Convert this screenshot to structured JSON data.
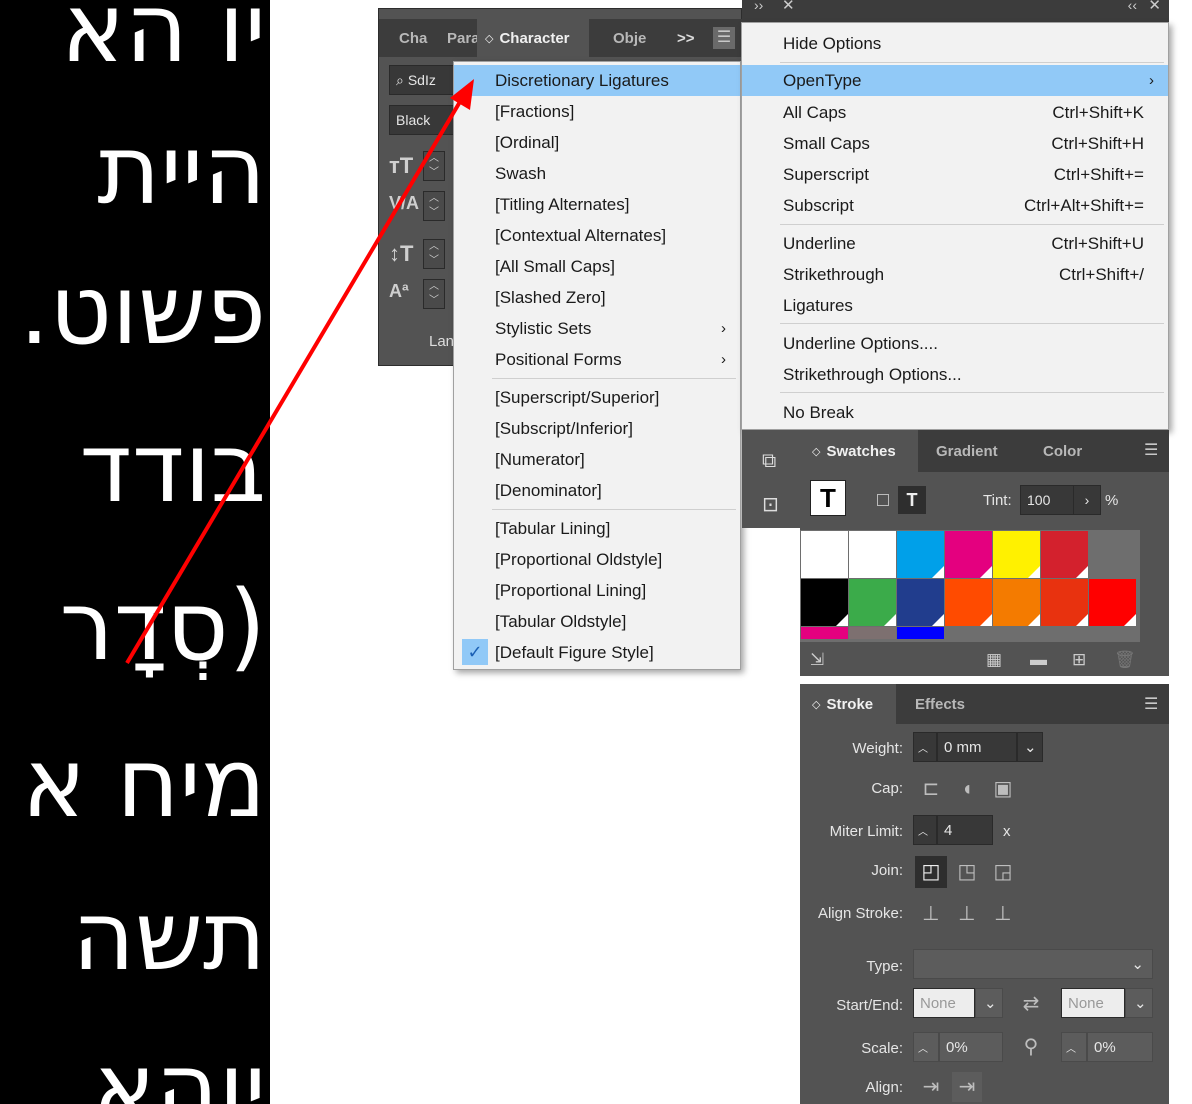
{
  "hebrew_lines": [
    "יו הא",
    "היית",
    "פשוט.",
    "בודד",
    "(סְדָר",
    "מיח א",
    "תשה",
    "יוהא"
  ],
  "character_panel": {
    "tabs": [
      "Cha",
      "Para",
      "Character",
      "Obje"
    ],
    "overflow": ">>",
    "font_field": "SdIz",
    "style_field": "Black",
    "language_label": "Lan"
  },
  "opentype_submenu": {
    "items": [
      "Discretionary Ligatures",
      "[Fractions]",
      "[Ordinal]",
      "Swash",
      "[Titling Alternates]",
      "[Contextual Alternates]",
      "[All Small Caps]",
      "[Slashed Zero]",
      "Stylistic Sets",
      "Positional Forms",
      "[Superscript/Superior]",
      "[Subscript/Inferior]",
      "[Numerator]",
      "[Denominator]",
      "[Tabular Lining]",
      "[Proportional Oldstyle]",
      "[Proportional Lining]",
      "[Tabular Oldstyle]",
      "[Default Figure Style]"
    ],
    "arrow": "›",
    "check": "✓"
  },
  "main_menu": {
    "items": [
      {
        "label": "Hide Options",
        "shortcut": ""
      },
      {
        "label": "OpenType",
        "shortcut": ""
      },
      {
        "label": "All Caps",
        "shortcut": "Ctrl+Shift+K"
      },
      {
        "label": "Small Caps",
        "shortcut": "Ctrl+Shift+H"
      },
      {
        "label": "Superscript",
        "shortcut": "Ctrl+Shift+="
      },
      {
        "label": "Subscript",
        "shortcut": "Ctrl+Alt+Shift+="
      },
      {
        "label": "Underline",
        "shortcut": "Ctrl+Shift+U"
      },
      {
        "label": "Strikethrough",
        "shortcut": "Ctrl+Shift+/"
      },
      {
        "label": "Ligatures",
        "shortcut": ""
      },
      {
        "label": "Underline Options....",
        "shortcut": ""
      },
      {
        "label": "Strikethrough Options...",
        "shortcut": ""
      },
      {
        "label": "No Break",
        "shortcut": ""
      }
    ],
    "arrow": "›"
  },
  "swatches_panel": {
    "tabs": [
      "Swatches",
      "Gradient",
      "Color"
    ],
    "tint_label": "Tint:",
    "tint_value": "100",
    "tint_unit": "%",
    "colors_row1": [
      "#ffffff",
      "#ffffff",
      "#00a0e9",
      "#e4007f",
      "#fff100",
      "#d3212d"
    ],
    "colors_row2": [
      "#000000",
      "#3bab4a",
      "#213d8d",
      "#ff4b00",
      "#f47b00",
      "#e8320f",
      "#ff0000"
    ],
    "strip_colors": [
      "#e4007f",
      "#7d7070",
      "#0000ff"
    ]
  },
  "stroke_panel": {
    "tabs": [
      "Stroke",
      "Effects"
    ],
    "weight_label": "Weight:",
    "weight_value": "0 mm",
    "cap_label": "Cap:",
    "miter_label": "Miter Limit:",
    "miter_value": "4",
    "miter_unit": "x",
    "join_label": "Join:",
    "align_label": "Align Stroke:",
    "type_label": "Type:",
    "startend_label": "Start/End:",
    "start_value": "None",
    "end_value": "None",
    "scale_label": "Scale:",
    "scale_start": "0%",
    "scale_end": "0%",
    "align2_label": "Align:"
  },
  "colors": {
    "accent_highlight": "#91c9f7",
    "panel_bg": "#535353",
    "arrow_red": "#ff0000"
  }
}
